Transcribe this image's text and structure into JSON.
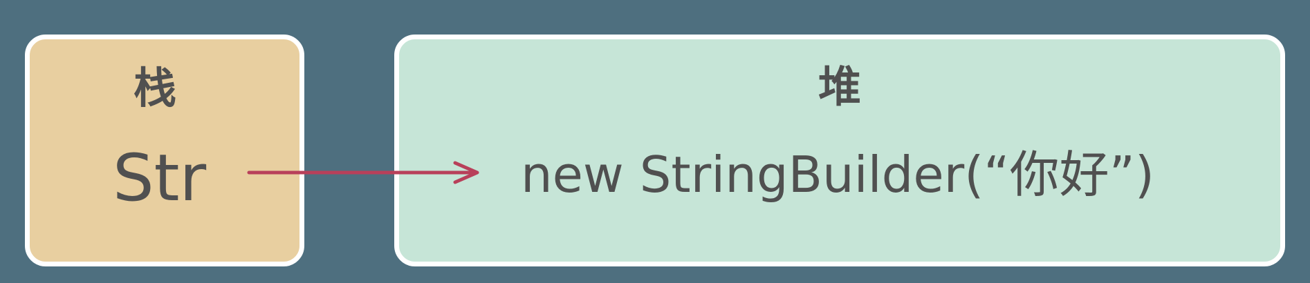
{
  "stack": {
    "title": "栈",
    "variable": "Str"
  },
  "heap": {
    "title": "堆",
    "object": "new StringBuilder(“你好”)"
  },
  "colors": {
    "background": "#4e6f7f",
    "stack_fill": "#e8cfa0",
    "heap_fill": "#c6e5d7",
    "border": "#ffffff",
    "arrow": "#b8405a",
    "text": "#505050"
  }
}
